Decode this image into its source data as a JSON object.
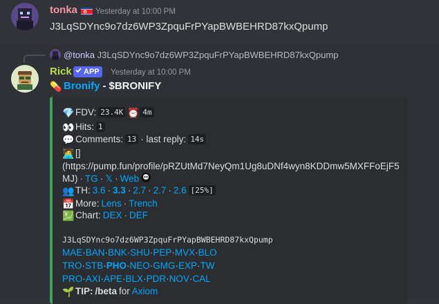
{
  "message1": {
    "username": "tonka",
    "timestamp": "Yesterday at 10:00 PM",
    "content": "J3LqSDYnc9o7dz6WP3ZpquFrPYapBWBEHRD87kxQpump"
  },
  "reply": {
    "mention": "@tonka",
    "content": "J3LqSDYnc9o7dz6WP3ZpquFrPYapBWBEHRD87kxQpump"
  },
  "message2": {
    "username": "Rick",
    "badge": "APP",
    "timestamp": "Yesterday at 10:00 PM",
    "title_link": "Bronify",
    "title_sep": "-",
    "title_ticker": "$BRONIFY"
  },
  "embed": {
    "fdv_label": "FDV:",
    "fdv_value": "23.4K",
    "fdv_age": "4m",
    "hits_label": "Hits:",
    "hits_value": "1",
    "comments_label": "Comments:",
    "comments_value": "13",
    "last_reply_label": "· last reply:",
    "last_reply_value": "14s",
    "profile_brackets": "[]",
    "profile_url": "(https://pump.fun/profile/pRZUtMd7NeyQm1Ug8uDNf4wyn8KDDmw5MXFFoEjF5",
    "profile_url_end": "MJ)",
    "tg_link": "TG",
    "x_link": "𝕏",
    "web_link": "Web",
    "th_label": "TH:",
    "th_values": [
      "3.6",
      "3.3",
      "2.7",
      "2.7",
      "2.6"
    ],
    "th_pct": "[25%]",
    "more_label": "More:",
    "more_links": [
      "Lens",
      "Trench"
    ],
    "chart_label": "Chart:",
    "chart_links": [
      "DEX",
      "DEF"
    ],
    "address": "J3LqSDYnc9o7dz6WP3ZpquFrPYapBWBEHRD87kxQpump",
    "platforms_row1": [
      "MAE",
      "BAN",
      "BNK",
      "SHU",
      "PEP",
      "MVX",
      "BLO"
    ],
    "platforms_row2": [
      "TRO",
      "STB",
      "PHO",
      "NEO",
      "GMG",
      "EXP",
      "TW"
    ],
    "platforms_row3": [
      "PRO",
      "AXI",
      "APE",
      "BLX",
      "PDR",
      "NOV",
      "CAL"
    ],
    "tip_label": "TIP:",
    "tip_cmd": "/beta",
    "tip_for": "for",
    "tip_link": "Axiom"
  },
  "colors": {
    "accent_link": "#00a8fc",
    "embed_border": "#3ba55d",
    "tonka_name": "#f297a5",
    "rick_name": "#b7e04d",
    "app_badge": "#5865f2"
  },
  "icons": {
    "fdv": "diamond-icon",
    "age": "alarm-clock-icon",
    "hits": "eyes-icon",
    "comments": "speech-bubble-icon",
    "profile": "person-at-computer-icon",
    "th": "busts-icon",
    "more": "calendar-icon",
    "chart": "chart-yen-icon",
    "tip": "seedling-icon",
    "title": "pill-icon"
  }
}
